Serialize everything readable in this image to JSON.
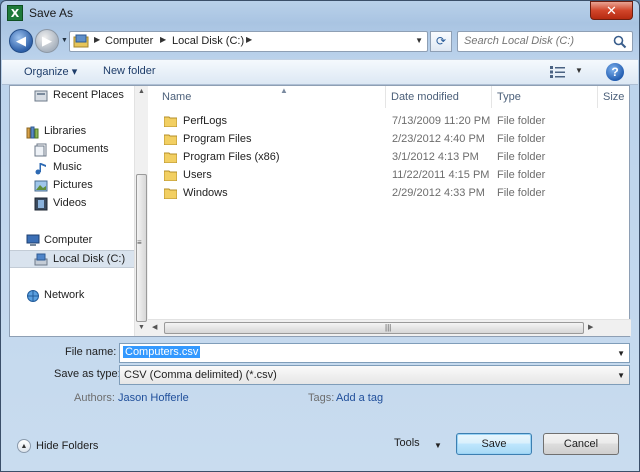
{
  "window": {
    "title": "Save As",
    "app_icon": "X"
  },
  "address": {
    "crumbs": [
      "Computer",
      "Local Disk (C:)"
    ],
    "search_placeholder": "Search Local Disk (C:)"
  },
  "toolbar": {
    "organize": "Organize",
    "new_folder": "New folder"
  },
  "nav": {
    "items": [
      {
        "label": "Recent Places",
        "icon": "recent-places-icon"
      },
      {
        "label": "Libraries",
        "icon": "libraries-icon"
      },
      {
        "label": "Documents",
        "icon": "documents-icon"
      },
      {
        "label": "Music",
        "icon": "music-icon"
      },
      {
        "label": "Pictures",
        "icon": "pictures-icon"
      },
      {
        "label": "Videos",
        "icon": "videos-icon"
      },
      {
        "label": "Computer",
        "icon": "computer-icon"
      },
      {
        "label": "Local Disk (C:)",
        "icon": "local-disk-icon",
        "selected": true
      },
      {
        "label": "Network",
        "icon": "network-icon"
      }
    ]
  },
  "files": {
    "columns": [
      "Name",
      "Date modified",
      "Type",
      "Size"
    ],
    "rows": [
      {
        "name": "PerfLogs",
        "date": "7/13/2009 11:20 PM",
        "type": "File folder"
      },
      {
        "name": "Program Files",
        "date": "2/23/2012 4:40 PM",
        "type": "File folder"
      },
      {
        "name": "Program Files (x86)",
        "date": "3/1/2012 4:13 PM",
        "type": "File folder"
      },
      {
        "name": "Users",
        "date": "11/22/2011 4:15 PM",
        "type": "File folder"
      },
      {
        "name": "Windows",
        "date": "2/29/2012 4:33 PM",
        "type": "File folder"
      }
    ]
  },
  "form": {
    "file_name_label": "File name:",
    "file_name_value": "Computers.csv",
    "save_type_label": "Save as type:",
    "save_type_value": "CSV (Comma delimited) (*.csv)",
    "authors_label": "Authors:",
    "authors_value": "Jason Hofferle",
    "tags_label": "Tags:",
    "tags_value": "Add a tag"
  },
  "footer": {
    "hide_folders": "Hide Folders",
    "tools": "Tools",
    "save": "Save",
    "cancel": "Cancel"
  }
}
